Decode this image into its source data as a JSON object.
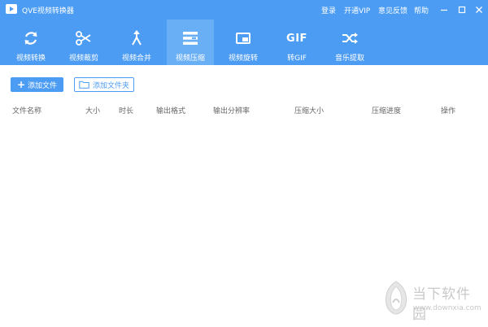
{
  "window": {
    "title": "QVE视频转换器",
    "links": {
      "login": "登录",
      "vip": "开通VIP",
      "feedback": "意见反馈",
      "help": "帮助"
    }
  },
  "toolbar": {
    "active_index": 3,
    "items": [
      {
        "label": "视频转换",
        "icon": "convert-arrows-icon"
      },
      {
        "label": "视频裁剪",
        "icon": "scissors-icon"
      },
      {
        "label": "视频合并",
        "icon": "merge-icon"
      },
      {
        "label": "视频压缩",
        "icon": "compress-icon"
      },
      {
        "label": "视频旋转",
        "icon": "rotate-screen-icon"
      },
      {
        "label": "转GIF",
        "icon": "gif-icon",
        "icon_text": "GIF"
      },
      {
        "label": "音乐提取",
        "icon": "shuffle-icon"
      }
    ]
  },
  "actions": {
    "add_file": "添加文件",
    "add_folder": "添加文件夹"
  },
  "table": {
    "columns": [
      "文件名称",
      "大小",
      "时长",
      "输出格式",
      "输出分辨率",
      "压缩大小",
      "压缩进度",
      "操作"
    ]
  },
  "watermark": {
    "name": "当下软件园",
    "url": "www.downxia.com"
  },
  "colors": {
    "primary": "#4c9cf3",
    "active_tab": "#69aff6",
    "text": "#666666",
    "watermark": "#c9c9c9"
  }
}
